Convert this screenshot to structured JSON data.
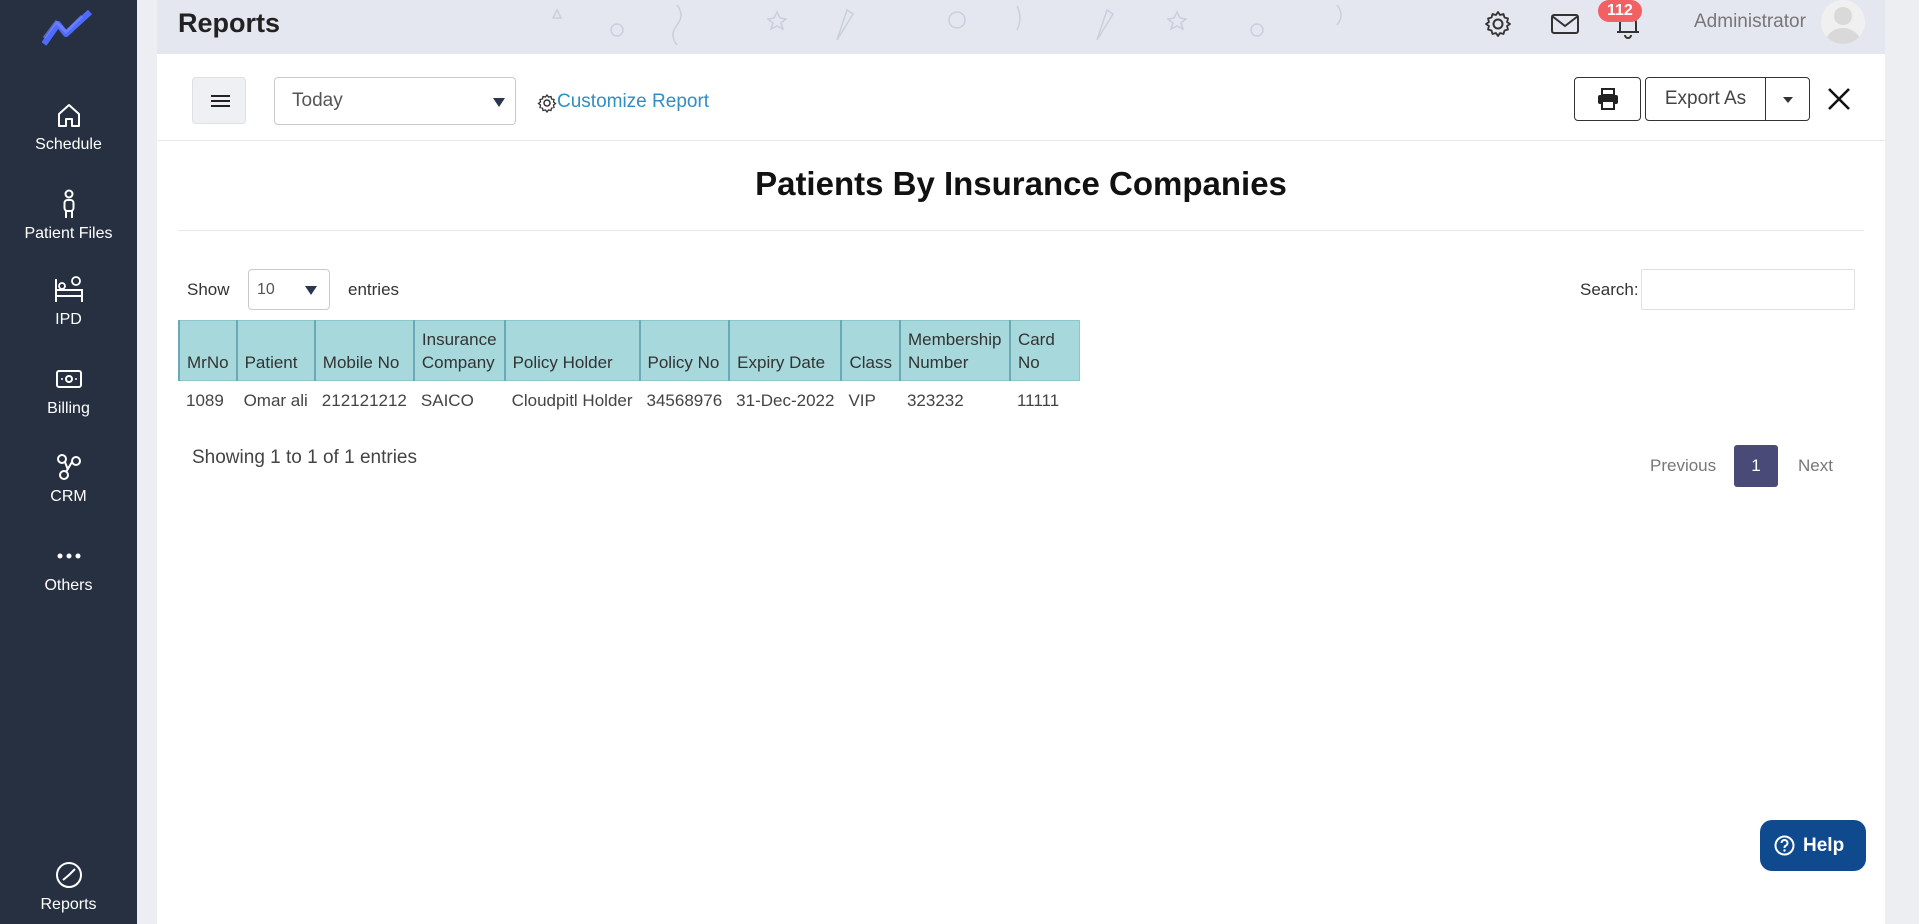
{
  "sidebar": {
    "items": [
      {
        "label": "Schedule",
        "icon": "home-icon"
      },
      {
        "label": "Patient Files",
        "icon": "person-icon"
      },
      {
        "label": "IPD",
        "icon": "bed-icon"
      },
      {
        "label": "Billing",
        "icon": "cash-icon"
      },
      {
        "label": "CRM",
        "icon": "crm-icon"
      },
      {
        "label": "Others",
        "icon": "more-icon"
      },
      {
        "label": "Reports",
        "icon": "reports-icon"
      }
    ]
  },
  "header": {
    "title": "Reports",
    "notification_count": "112",
    "user_name": "Administrator"
  },
  "toolbar": {
    "date_range": "Today",
    "customize_label": "Customize Report",
    "export_label": "Export As"
  },
  "report": {
    "title": "Patients By Insurance Companies",
    "show_label": "Show",
    "page_length": "10",
    "entries_label": "entries",
    "search_label": "Search:",
    "columns": [
      "MrNo",
      "Patient",
      "Mobile No",
      "Insurance Company",
      "Policy Holder",
      "Policy No",
      "Expiry Date",
      "Class",
      "Membership Number",
      "Card No"
    ],
    "rows": [
      [
        "1089",
        "Omar ali",
        "212121212",
        "SAICO",
        "Cloudpitl Holder",
        "34568976",
        "31-Dec-2022",
        "VIP",
        "323232",
        "11111"
      ]
    ],
    "info": "Showing 1 to 1 of 1 entries",
    "pagination": {
      "previous": "Previous",
      "current": "1",
      "next": "Next"
    }
  },
  "help": {
    "label": "Help"
  },
  "colors": {
    "sidebar": "#263040",
    "table_header": "#a6d8dc",
    "link": "#2d8fc4",
    "badge": "#f16062",
    "help": "#0f4a8f",
    "page_active": "#4a4a78"
  }
}
